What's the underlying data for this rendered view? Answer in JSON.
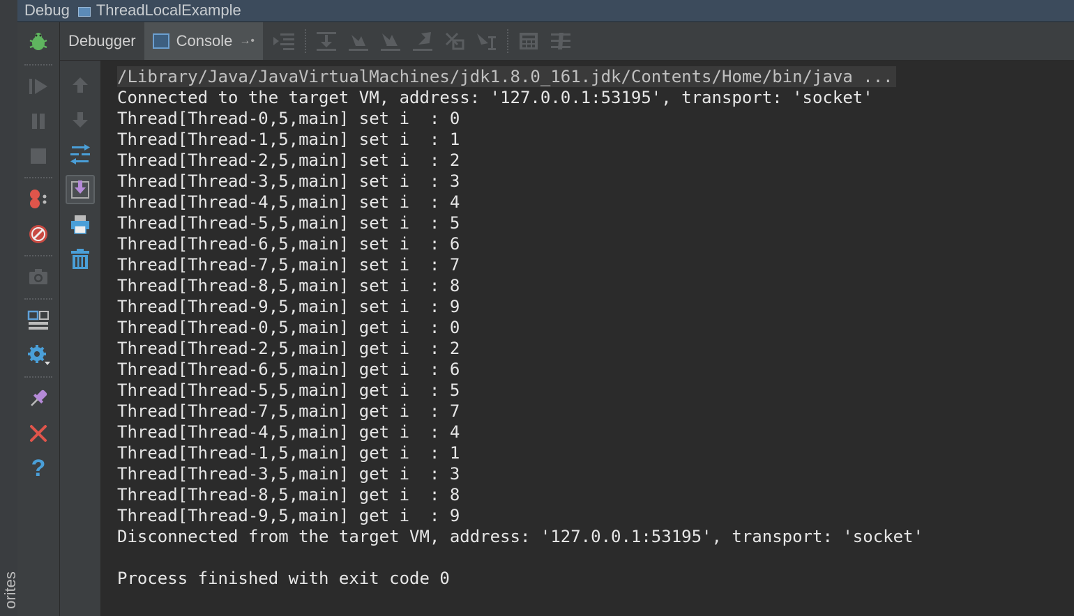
{
  "window": {
    "title_prefix": "Debug",
    "title": "ThreadLocalExample"
  },
  "favorites_label": "orites",
  "tabs": [
    {
      "label": "Debugger"
    },
    {
      "label": "Console"
    }
  ],
  "toolbar_icons": [
    "show-execution-point-icon",
    "step-over-icon",
    "step-into-icon",
    "force-step-into-icon",
    "step-out-icon",
    "drop-frame-icon",
    "run-to-cursor-icon",
    "evaluate-expression-icon",
    "trace-icon"
  ],
  "left_toolbar_icons": [
    "debug-bug-icon",
    "resume-icon",
    "pause-icon",
    "stop-icon",
    "view-breakpoints-icon",
    "mute-breakpoints-icon",
    "get-thread-dump-icon",
    "restore-layout-icon",
    "settings-icon",
    "pin-tab-icon",
    "close-icon",
    "help-icon"
  ],
  "console_toolbar_icons": [
    "up-arrow-icon",
    "down-arrow-icon",
    "soft-wrap-icon",
    "scroll-to-end-icon",
    "print-icon",
    "clear-all-icon"
  ],
  "console": {
    "lines": [
      "/Library/Java/JavaVirtualMachines/jdk1.8.0_161.jdk/Contents/Home/bin/java ...",
      "Connected to the target VM, address: '127.0.0.1:53195', transport: 'socket'",
      "Thread[Thread-0,5,main] set i  : 0",
      "Thread[Thread-1,5,main] set i  : 1",
      "Thread[Thread-2,5,main] set i  : 2",
      "Thread[Thread-3,5,main] set i  : 3",
      "Thread[Thread-4,5,main] set i  : 4",
      "Thread[Thread-5,5,main] set i  : 5",
      "Thread[Thread-6,5,main] set i  : 6",
      "Thread[Thread-7,5,main] set i  : 7",
      "Thread[Thread-8,5,main] set i  : 8",
      "Thread[Thread-9,5,main] set i  : 9",
      "Thread[Thread-0,5,main] get i  : 0",
      "Thread[Thread-2,5,main] get i  : 2",
      "Thread[Thread-6,5,main] get i  : 6",
      "Thread[Thread-5,5,main] get i  : 5",
      "Thread[Thread-7,5,main] get i  : 7",
      "Thread[Thread-4,5,main] get i  : 4",
      "Thread[Thread-1,5,main] get i  : 1",
      "Thread[Thread-3,5,main] get i  : 3",
      "Thread[Thread-8,5,main] get i  : 8",
      "Thread[Thread-9,5,main] get i  : 9",
      "Disconnected from the target VM, address: '127.0.0.1:53195', transport: 'socket'",
      "",
      "Process finished with exit code 0"
    ]
  },
  "colors": {
    "background": "#2b2b2b",
    "panel": "#3c3f41",
    "text": "#e6e6e6",
    "accent_blue": "#4a9fd8",
    "close_red": "#e0554b",
    "bug_green": "#5fb55f"
  }
}
